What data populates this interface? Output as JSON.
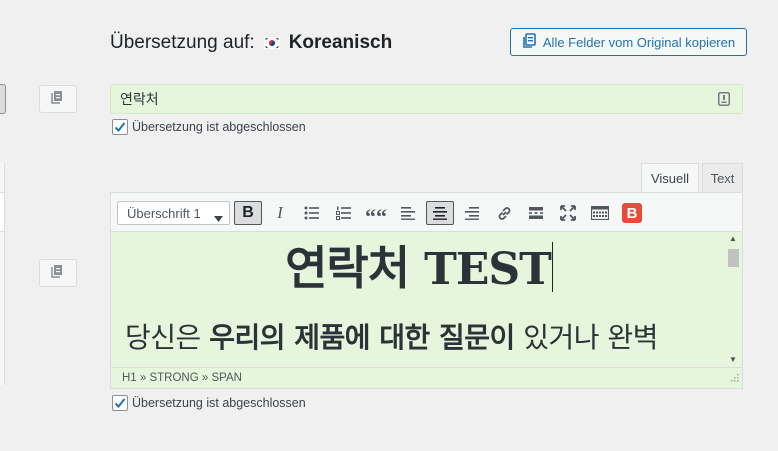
{
  "header": {
    "label": "Übersetzung auf:",
    "flag_icon": "korea-flag-icon",
    "language": "Koreanisch",
    "copy_all_button": "Alle Felder vom Original kopieren"
  },
  "title_field": {
    "value": "연락처",
    "completed_label": "Übersetzung ist abgeschlossen",
    "completed": true
  },
  "editor": {
    "tabs": [
      {
        "label": "Visuell",
        "active": true
      },
      {
        "label": "Text",
        "active": false
      }
    ],
    "format_select": "Überschrift 1",
    "toolbar_icons": [
      "bold-icon",
      "italic-icon",
      "bullet-list-icon",
      "numbered-list-icon",
      "blockquote-icon",
      "align-left-icon",
      "align-center-icon",
      "align-right-icon",
      "link-icon",
      "read-more-icon",
      "fullscreen-icon",
      "toolbar-toggle-icon",
      "bricks-builder-icon"
    ],
    "bold_label": "B",
    "italic_label": "I",
    "quote_label": "““",
    "brand_button_label": "B",
    "content": {
      "heading_ko": "연락처",
      "heading_latin": "TEST",
      "para_start": "당신은 ",
      "para_strong": "우리의 제품에 대한 질문이",
      "para_end": " 있거나 완벽"
    },
    "path": "H1 » STRONG » SPAN",
    "completed_label": "Übersetzung ist abgeschlossen",
    "completed": true
  },
  "colors": {
    "accent": "#2271b1",
    "translated_bg": "#e6f6dd",
    "brand_red": "#e44d3a"
  }
}
